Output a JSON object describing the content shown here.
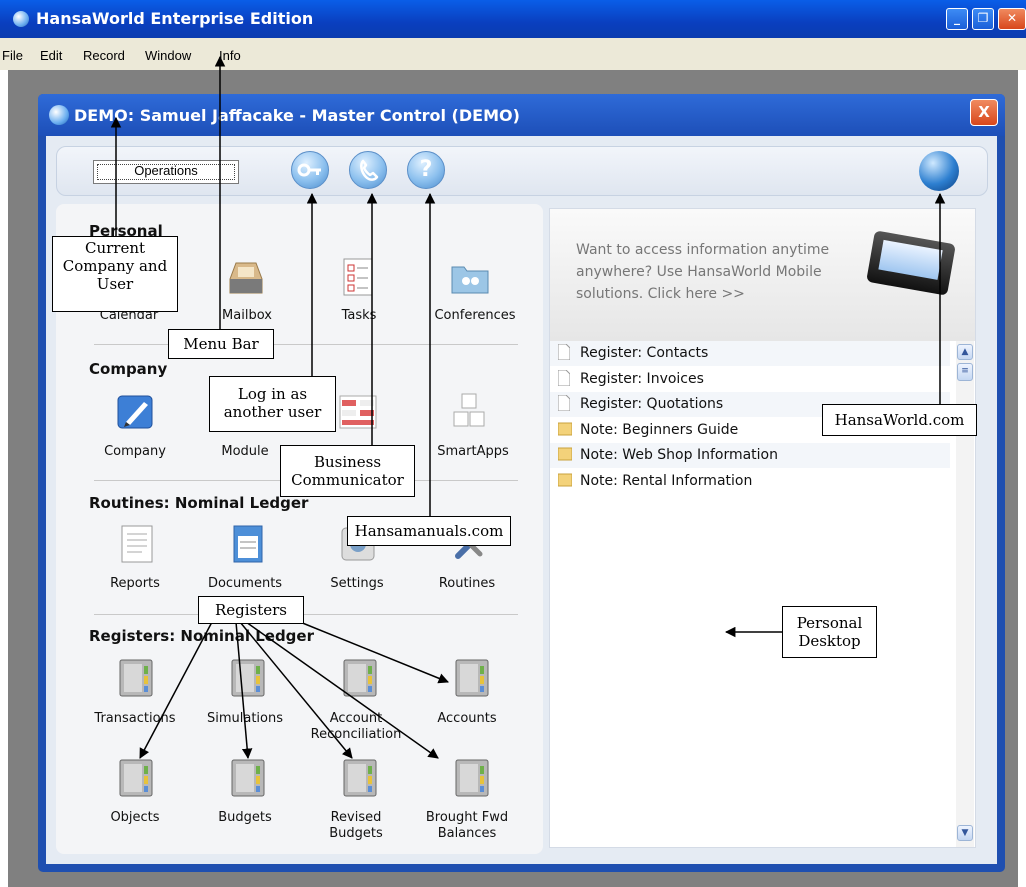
{
  "app": {
    "title": "HansaWorld Enterprise Edition"
  },
  "menu": [
    "File",
    "Edit",
    "Record",
    "Window",
    "Info"
  ],
  "window": {
    "title": "DEMO: Samuel Jaffacake - Master Control (DEMO)",
    "close": "X"
  },
  "toolbar": {
    "operations_label": "Operations",
    "help_glyph": "?"
  },
  "sections": {
    "personal": "Personal",
    "company": "Company",
    "routines": "Routines: Nominal Ledger",
    "registers": "Registers: Nominal Ledger"
  },
  "personal_items": [
    "Calendar",
    "Mailbox",
    "Tasks",
    "Conferences"
  ],
  "company_items": [
    "Company",
    "Module",
    "",
    "SmartApps"
  ],
  "routine_items": [
    "Reports",
    "Documents",
    "Settings",
    "Routines"
  ],
  "register_items": {
    "r1": [
      "Transactions",
      "Simulations",
      "Account Reconciliation",
      "Accounts"
    ],
    "r2": [
      "Objects",
      "Budgets",
      "Revised Budgets",
      "Brought Fwd Balances"
    ]
  },
  "banner": {
    "text": "Want to access information anytime anywhere? Use HansaWorld Mobile solutions. Click here >>"
  },
  "desktop_items": [
    {
      "label": "Register: Contacts",
      "kind": "doc"
    },
    {
      "label": "Register: Invoices",
      "kind": "doc"
    },
    {
      "label": "Register: Quotations",
      "kind": "doc"
    },
    {
      "label": "Note: Beginners Guide",
      "kind": "note"
    },
    {
      "label": "Note: Web Shop Information",
      "kind": "note"
    },
    {
      "label": "Note: Rental Information",
      "kind": "note"
    }
  ],
  "callouts": {
    "current_company": "Current Company and User",
    "menu_bar": "Menu Bar",
    "log_in": "Log in as another user",
    "business_communicator": "Business Communicator",
    "hansamanuals": "Hansamanuals.com",
    "registers": "Registers",
    "hansaworld": "HansaWorld.com",
    "personal_desktop": "Personal Desktop"
  },
  "colors": {
    "title_blue": "#0a4fd8",
    "menu_bg": "#ece9d8",
    "pane_bg": "#f4f5f7"
  }
}
